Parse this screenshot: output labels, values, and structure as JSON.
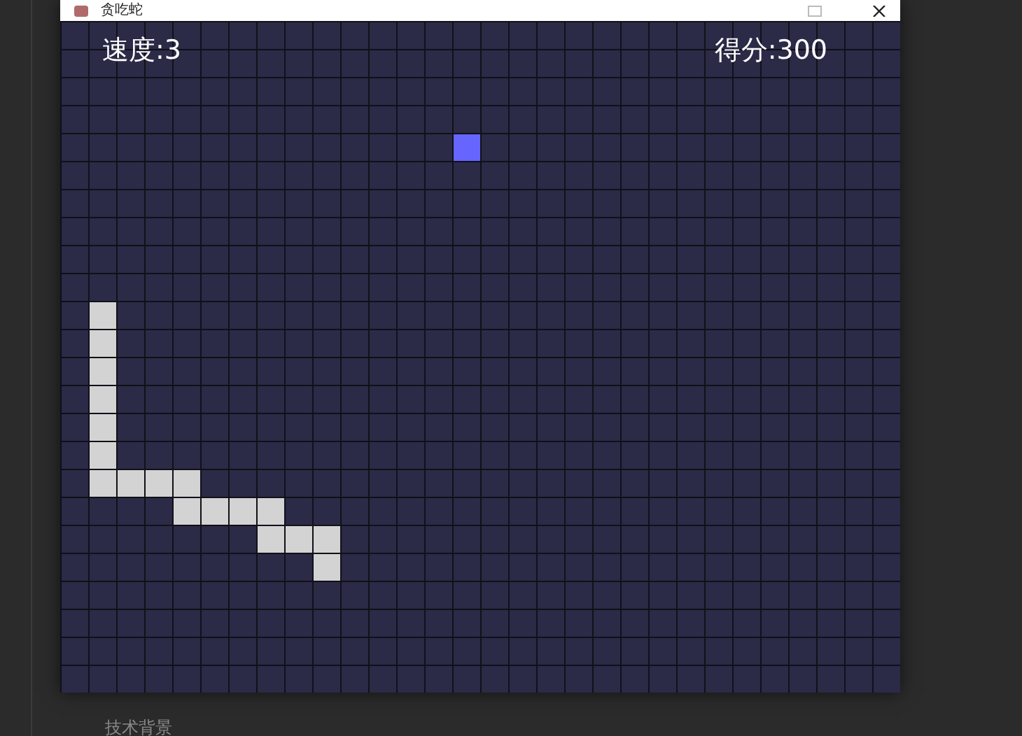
{
  "window": {
    "title": "贪吃蛇"
  },
  "hud": {
    "speed": "速度:3",
    "score": "得分:300"
  },
  "board": {
    "rows": [
      {
        "cells": [
          {
            "kind": "empty"
          },
          {
            "kind": "empty"
          },
          {
            "kind": "empty"
          },
          {
            "kind": "empty"
          },
          {
            "kind": "empty"
          },
          {
            "kind": "empty"
          },
          {
            "kind": "empty"
          },
          {
            "kind": "empty"
          },
          {
            "kind": "empty"
          },
          {
            "kind": "empty"
          },
          {
            "kind": "empty"
          },
          {
            "kind": "empty"
          },
          {
            "kind": "empty"
          },
          {
            "kind": "empty"
          },
          {
            "kind": "empty"
          },
          {
            "kind": "empty"
          },
          {
            "kind": "empty"
          },
          {
            "kind": "empty"
          },
          {
            "kind": "empty"
          },
          {
            "kind": "empty"
          },
          {
            "kind": "empty"
          },
          {
            "kind": "empty"
          },
          {
            "kind": "empty"
          },
          {
            "kind": "empty"
          },
          {
            "kind": "empty"
          },
          {
            "kind": "empty"
          },
          {
            "kind": "empty"
          },
          {
            "kind": "empty"
          },
          {
            "kind": "empty"
          },
          {
            "kind": "empty"
          }
        ]
      },
      {
        "cells": [
          {
            "kind": "empty"
          },
          {
            "kind": "empty"
          },
          {
            "kind": "empty"
          },
          {
            "kind": "empty"
          },
          {
            "kind": "empty"
          },
          {
            "kind": "empty"
          },
          {
            "kind": "empty"
          },
          {
            "kind": "empty"
          },
          {
            "kind": "empty"
          },
          {
            "kind": "empty"
          },
          {
            "kind": "empty"
          },
          {
            "kind": "empty"
          },
          {
            "kind": "empty"
          },
          {
            "kind": "empty"
          },
          {
            "kind": "empty"
          },
          {
            "kind": "empty"
          },
          {
            "kind": "empty"
          },
          {
            "kind": "empty"
          },
          {
            "kind": "empty"
          },
          {
            "kind": "empty"
          },
          {
            "kind": "empty"
          },
          {
            "kind": "empty"
          },
          {
            "kind": "empty"
          },
          {
            "kind": "empty"
          },
          {
            "kind": "empty"
          },
          {
            "kind": "empty"
          },
          {
            "kind": "empty"
          },
          {
            "kind": "empty"
          },
          {
            "kind": "empty"
          },
          {
            "kind": "empty"
          }
        ]
      },
      {
        "cells": [
          {
            "kind": "empty"
          },
          {
            "kind": "empty"
          },
          {
            "kind": "empty"
          },
          {
            "kind": "empty"
          },
          {
            "kind": "empty"
          },
          {
            "kind": "empty"
          },
          {
            "kind": "empty"
          },
          {
            "kind": "empty"
          },
          {
            "kind": "empty"
          },
          {
            "kind": "empty"
          },
          {
            "kind": "empty"
          },
          {
            "kind": "empty"
          },
          {
            "kind": "empty"
          },
          {
            "kind": "empty"
          },
          {
            "kind": "empty"
          },
          {
            "kind": "empty"
          },
          {
            "kind": "empty"
          },
          {
            "kind": "empty"
          },
          {
            "kind": "empty"
          },
          {
            "kind": "empty"
          },
          {
            "kind": "empty"
          },
          {
            "kind": "empty"
          },
          {
            "kind": "empty"
          },
          {
            "kind": "empty"
          },
          {
            "kind": "empty"
          },
          {
            "kind": "empty"
          },
          {
            "kind": "empty"
          },
          {
            "kind": "empty"
          },
          {
            "kind": "empty"
          },
          {
            "kind": "empty"
          }
        ]
      },
      {
        "cells": [
          {
            "kind": "empty"
          },
          {
            "kind": "empty"
          },
          {
            "kind": "empty"
          },
          {
            "kind": "empty"
          },
          {
            "kind": "empty"
          },
          {
            "kind": "empty"
          },
          {
            "kind": "empty"
          },
          {
            "kind": "empty"
          },
          {
            "kind": "empty"
          },
          {
            "kind": "empty"
          },
          {
            "kind": "empty"
          },
          {
            "kind": "empty"
          },
          {
            "kind": "empty"
          },
          {
            "kind": "empty"
          },
          {
            "kind": "empty"
          },
          {
            "kind": "empty"
          },
          {
            "kind": "empty"
          },
          {
            "kind": "empty"
          },
          {
            "kind": "empty"
          },
          {
            "kind": "empty"
          },
          {
            "kind": "empty"
          },
          {
            "kind": "empty"
          },
          {
            "kind": "empty"
          },
          {
            "kind": "empty"
          },
          {
            "kind": "empty"
          },
          {
            "kind": "empty"
          },
          {
            "kind": "empty"
          },
          {
            "kind": "empty"
          },
          {
            "kind": "empty"
          },
          {
            "kind": "empty"
          }
        ]
      },
      {
        "cells": [
          {
            "kind": "empty"
          },
          {
            "kind": "empty"
          },
          {
            "kind": "empty"
          },
          {
            "kind": "empty"
          },
          {
            "kind": "empty"
          },
          {
            "kind": "empty"
          },
          {
            "kind": "empty"
          },
          {
            "kind": "empty"
          },
          {
            "kind": "empty"
          },
          {
            "kind": "empty"
          },
          {
            "kind": "empty"
          },
          {
            "kind": "empty"
          },
          {
            "kind": "empty"
          },
          {
            "kind": "empty"
          },
          {
            "kind": "food"
          },
          {
            "kind": "empty"
          },
          {
            "kind": "empty"
          },
          {
            "kind": "empty"
          },
          {
            "kind": "empty"
          },
          {
            "kind": "empty"
          },
          {
            "kind": "empty"
          },
          {
            "kind": "empty"
          },
          {
            "kind": "empty"
          },
          {
            "kind": "empty"
          },
          {
            "kind": "empty"
          },
          {
            "kind": "empty"
          },
          {
            "kind": "empty"
          },
          {
            "kind": "empty"
          },
          {
            "kind": "empty"
          },
          {
            "kind": "empty"
          }
        ]
      },
      {
        "cells": [
          {
            "kind": "empty"
          },
          {
            "kind": "empty"
          },
          {
            "kind": "empty"
          },
          {
            "kind": "empty"
          },
          {
            "kind": "empty"
          },
          {
            "kind": "empty"
          },
          {
            "kind": "empty"
          },
          {
            "kind": "empty"
          },
          {
            "kind": "empty"
          },
          {
            "kind": "empty"
          },
          {
            "kind": "empty"
          },
          {
            "kind": "empty"
          },
          {
            "kind": "empty"
          },
          {
            "kind": "empty"
          },
          {
            "kind": "empty"
          },
          {
            "kind": "empty"
          },
          {
            "kind": "empty"
          },
          {
            "kind": "empty"
          },
          {
            "kind": "empty"
          },
          {
            "kind": "empty"
          },
          {
            "kind": "empty"
          },
          {
            "kind": "empty"
          },
          {
            "kind": "empty"
          },
          {
            "kind": "empty"
          },
          {
            "kind": "empty"
          },
          {
            "kind": "empty"
          },
          {
            "kind": "empty"
          },
          {
            "kind": "empty"
          },
          {
            "kind": "empty"
          },
          {
            "kind": "empty"
          }
        ]
      },
      {
        "cells": [
          {
            "kind": "empty"
          },
          {
            "kind": "empty"
          },
          {
            "kind": "empty"
          },
          {
            "kind": "empty"
          },
          {
            "kind": "empty"
          },
          {
            "kind": "empty"
          },
          {
            "kind": "empty"
          },
          {
            "kind": "empty"
          },
          {
            "kind": "empty"
          },
          {
            "kind": "empty"
          },
          {
            "kind": "empty"
          },
          {
            "kind": "empty"
          },
          {
            "kind": "empty"
          },
          {
            "kind": "empty"
          },
          {
            "kind": "empty"
          },
          {
            "kind": "empty"
          },
          {
            "kind": "empty"
          },
          {
            "kind": "empty"
          },
          {
            "kind": "empty"
          },
          {
            "kind": "empty"
          },
          {
            "kind": "empty"
          },
          {
            "kind": "empty"
          },
          {
            "kind": "empty"
          },
          {
            "kind": "empty"
          },
          {
            "kind": "empty"
          },
          {
            "kind": "empty"
          },
          {
            "kind": "empty"
          },
          {
            "kind": "empty"
          },
          {
            "kind": "empty"
          },
          {
            "kind": "empty"
          }
        ]
      },
      {
        "cells": [
          {
            "kind": "empty"
          },
          {
            "kind": "empty"
          },
          {
            "kind": "empty"
          },
          {
            "kind": "empty"
          },
          {
            "kind": "empty"
          },
          {
            "kind": "empty"
          },
          {
            "kind": "empty"
          },
          {
            "kind": "empty"
          },
          {
            "kind": "empty"
          },
          {
            "kind": "empty"
          },
          {
            "kind": "empty"
          },
          {
            "kind": "empty"
          },
          {
            "kind": "empty"
          },
          {
            "kind": "empty"
          },
          {
            "kind": "empty"
          },
          {
            "kind": "empty"
          },
          {
            "kind": "empty"
          },
          {
            "kind": "empty"
          },
          {
            "kind": "empty"
          },
          {
            "kind": "empty"
          },
          {
            "kind": "empty"
          },
          {
            "kind": "empty"
          },
          {
            "kind": "empty"
          },
          {
            "kind": "empty"
          },
          {
            "kind": "empty"
          },
          {
            "kind": "empty"
          },
          {
            "kind": "empty"
          },
          {
            "kind": "empty"
          },
          {
            "kind": "empty"
          },
          {
            "kind": "empty"
          }
        ]
      },
      {
        "cells": [
          {
            "kind": "empty"
          },
          {
            "kind": "empty"
          },
          {
            "kind": "empty"
          },
          {
            "kind": "empty"
          },
          {
            "kind": "empty"
          },
          {
            "kind": "empty"
          },
          {
            "kind": "empty"
          },
          {
            "kind": "empty"
          },
          {
            "kind": "empty"
          },
          {
            "kind": "empty"
          },
          {
            "kind": "empty"
          },
          {
            "kind": "empty"
          },
          {
            "kind": "empty"
          },
          {
            "kind": "empty"
          },
          {
            "kind": "empty"
          },
          {
            "kind": "empty"
          },
          {
            "kind": "empty"
          },
          {
            "kind": "empty"
          },
          {
            "kind": "empty"
          },
          {
            "kind": "empty"
          },
          {
            "kind": "empty"
          },
          {
            "kind": "empty"
          },
          {
            "kind": "empty"
          },
          {
            "kind": "empty"
          },
          {
            "kind": "empty"
          },
          {
            "kind": "empty"
          },
          {
            "kind": "empty"
          },
          {
            "kind": "empty"
          },
          {
            "kind": "empty"
          },
          {
            "kind": "empty"
          }
        ]
      },
      {
        "cells": [
          {
            "kind": "empty"
          },
          {
            "kind": "empty"
          },
          {
            "kind": "empty"
          },
          {
            "kind": "empty"
          },
          {
            "kind": "empty"
          },
          {
            "kind": "empty"
          },
          {
            "kind": "empty"
          },
          {
            "kind": "empty"
          },
          {
            "kind": "empty"
          },
          {
            "kind": "empty"
          },
          {
            "kind": "empty"
          },
          {
            "kind": "empty"
          },
          {
            "kind": "empty"
          },
          {
            "kind": "empty"
          },
          {
            "kind": "empty"
          },
          {
            "kind": "empty"
          },
          {
            "kind": "empty"
          },
          {
            "kind": "empty"
          },
          {
            "kind": "empty"
          },
          {
            "kind": "empty"
          },
          {
            "kind": "empty"
          },
          {
            "kind": "empty"
          },
          {
            "kind": "empty"
          },
          {
            "kind": "empty"
          },
          {
            "kind": "empty"
          },
          {
            "kind": "empty"
          },
          {
            "kind": "empty"
          },
          {
            "kind": "empty"
          },
          {
            "kind": "empty"
          },
          {
            "kind": "empty"
          }
        ]
      },
      {
        "cells": [
          {
            "kind": "empty"
          },
          {
            "kind": "snake"
          },
          {
            "kind": "empty"
          },
          {
            "kind": "empty"
          },
          {
            "kind": "empty"
          },
          {
            "kind": "empty"
          },
          {
            "kind": "empty"
          },
          {
            "kind": "empty"
          },
          {
            "kind": "empty"
          },
          {
            "kind": "empty"
          },
          {
            "kind": "empty"
          },
          {
            "kind": "empty"
          },
          {
            "kind": "empty"
          },
          {
            "kind": "empty"
          },
          {
            "kind": "empty"
          },
          {
            "kind": "empty"
          },
          {
            "kind": "empty"
          },
          {
            "kind": "empty"
          },
          {
            "kind": "empty"
          },
          {
            "kind": "empty"
          },
          {
            "kind": "empty"
          },
          {
            "kind": "empty"
          },
          {
            "kind": "empty"
          },
          {
            "kind": "empty"
          },
          {
            "kind": "empty"
          },
          {
            "kind": "empty"
          },
          {
            "kind": "empty"
          },
          {
            "kind": "empty"
          },
          {
            "kind": "empty"
          },
          {
            "kind": "empty"
          }
        ]
      },
      {
        "cells": [
          {
            "kind": "empty"
          },
          {
            "kind": "snake"
          },
          {
            "kind": "empty"
          },
          {
            "kind": "empty"
          },
          {
            "kind": "empty"
          },
          {
            "kind": "empty"
          },
          {
            "kind": "empty"
          },
          {
            "kind": "empty"
          },
          {
            "kind": "empty"
          },
          {
            "kind": "empty"
          },
          {
            "kind": "empty"
          },
          {
            "kind": "empty"
          },
          {
            "kind": "empty"
          },
          {
            "kind": "empty"
          },
          {
            "kind": "empty"
          },
          {
            "kind": "empty"
          },
          {
            "kind": "empty"
          },
          {
            "kind": "empty"
          },
          {
            "kind": "empty"
          },
          {
            "kind": "empty"
          },
          {
            "kind": "empty"
          },
          {
            "kind": "empty"
          },
          {
            "kind": "empty"
          },
          {
            "kind": "empty"
          },
          {
            "kind": "empty"
          },
          {
            "kind": "empty"
          },
          {
            "kind": "empty"
          },
          {
            "kind": "empty"
          },
          {
            "kind": "empty"
          },
          {
            "kind": "empty"
          }
        ]
      },
      {
        "cells": [
          {
            "kind": "empty"
          },
          {
            "kind": "snake"
          },
          {
            "kind": "empty"
          },
          {
            "kind": "empty"
          },
          {
            "kind": "empty"
          },
          {
            "kind": "empty"
          },
          {
            "kind": "empty"
          },
          {
            "kind": "empty"
          },
          {
            "kind": "empty"
          },
          {
            "kind": "empty"
          },
          {
            "kind": "empty"
          },
          {
            "kind": "empty"
          },
          {
            "kind": "empty"
          },
          {
            "kind": "empty"
          },
          {
            "kind": "empty"
          },
          {
            "kind": "empty"
          },
          {
            "kind": "empty"
          },
          {
            "kind": "empty"
          },
          {
            "kind": "empty"
          },
          {
            "kind": "empty"
          },
          {
            "kind": "empty"
          },
          {
            "kind": "empty"
          },
          {
            "kind": "empty"
          },
          {
            "kind": "empty"
          },
          {
            "kind": "empty"
          },
          {
            "kind": "empty"
          },
          {
            "kind": "empty"
          },
          {
            "kind": "empty"
          },
          {
            "kind": "empty"
          },
          {
            "kind": "empty"
          }
        ]
      },
      {
        "cells": [
          {
            "kind": "empty"
          },
          {
            "kind": "snake"
          },
          {
            "kind": "empty"
          },
          {
            "kind": "empty"
          },
          {
            "kind": "empty"
          },
          {
            "kind": "empty"
          },
          {
            "kind": "empty"
          },
          {
            "kind": "empty"
          },
          {
            "kind": "empty"
          },
          {
            "kind": "empty"
          },
          {
            "kind": "empty"
          },
          {
            "kind": "empty"
          },
          {
            "kind": "empty"
          },
          {
            "kind": "empty"
          },
          {
            "kind": "empty"
          },
          {
            "kind": "empty"
          },
          {
            "kind": "empty"
          },
          {
            "kind": "empty"
          },
          {
            "kind": "empty"
          },
          {
            "kind": "empty"
          },
          {
            "kind": "empty"
          },
          {
            "kind": "empty"
          },
          {
            "kind": "empty"
          },
          {
            "kind": "empty"
          },
          {
            "kind": "empty"
          },
          {
            "kind": "empty"
          },
          {
            "kind": "empty"
          },
          {
            "kind": "empty"
          },
          {
            "kind": "empty"
          },
          {
            "kind": "empty"
          }
        ]
      },
      {
        "cells": [
          {
            "kind": "empty"
          },
          {
            "kind": "snake"
          },
          {
            "kind": "empty"
          },
          {
            "kind": "empty"
          },
          {
            "kind": "empty"
          },
          {
            "kind": "empty"
          },
          {
            "kind": "empty"
          },
          {
            "kind": "empty"
          },
          {
            "kind": "empty"
          },
          {
            "kind": "empty"
          },
          {
            "kind": "empty"
          },
          {
            "kind": "empty"
          },
          {
            "kind": "empty"
          },
          {
            "kind": "empty"
          },
          {
            "kind": "empty"
          },
          {
            "kind": "empty"
          },
          {
            "kind": "empty"
          },
          {
            "kind": "empty"
          },
          {
            "kind": "empty"
          },
          {
            "kind": "empty"
          },
          {
            "kind": "empty"
          },
          {
            "kind": "empty"
          },
          {
            "kind": "empty"
          },
          {
            "kind": "empty"
          },
          {
            "kind": "empty"
          },
          {
            "kind": "empty"
          },
          {
            "kind": "empty"
          },
          {
            "kind": "empty"
          },
          {
            "kind": "empty"
          },
          {
            "kind": "empty"
          }
        ]
      },
      {
        "cells": [
          {
            "kind": "empty"
          },
          {
            "kind": "snake"
          },
          {
            "kind": "empty"
          },
          {
            "kind": "empty"
          },
          {
            "kind": "empty"
          },
          {
            "kind": "empty"
          },
          {
            "kind": "empty"
          },
          {
            "kind": "empty"
          },
          {
            "kind": "empty"
          },
          {
            "kind": "empty"
          },
          {
            "kind": "empty"
          },
          {
            "kind": "empty"
          },
          {
            "kind": "empty"
          },
          {
            "kind": "empty"
          },
          {
            "kind": "empty"
          },
          {
            "kind": "empty"
          },
          {
            "kind": "empty"
          },
          {
            "kind": "empty"
          },
          {
            "kind": "empty"
          },
          {
            "kind": "empty"
          },
          {
            "kind": "empty"
          },
          {
            "kind": "empty"
          },
          {
            "kind": "empty"
          },
          {
            "kind": "empty"
          },
          {
            "kind": "empty"
          },
          {
            "kind": "empty"
          },
          {
            "kind": "empty"
          },
          {
            "kind": "empty"
          },
          {
            "kind": "empty"
          },
          {
            "kind": "empty"
          }
        ]
      },
      {
        "cells": [
          {
            "kind": "empty"
          },
          {
            "kind": "snake"
          },
          {
            "kind": "snake"
          },
          {
            "kind": "snake"
          },
          {
            "kind": "snake"
          },
          {
            "kind": "empty"
          },
          {
            "kind": "empty"
          },
          {
            "kind": "empty"
          },
          {
            "kind": "empty"
          },
          {
            "kind": "empty"
          },
          {
            "kind": "empty"
          },
          {
            "kind": "empty"
          },
          {
            "kind": "empty"
          },
          {
            "kind": "empty"
          },
          {
            "kind": "empty"
          },
          {
            "kind": "empty"
          },
          {
            "kind": "empty"
          },
          {
            "kind": "empty"
          },
          {
            "kind": "empty"
          },
          {
            "kind": "empty"
          },
          {
            "kind": "empty"
          },
          {
            "kind": "empty"
          },
          {
            "kind": "empty"
          },
          {
            "kind": "empty"
          },
          {
            "kind": "empty"
          },
          {
            "kind": "empty"
          },
          {
            "kind": "empty"
          },
          {
            "kind": "empty"
          },
          {
            "kind": "empty"
          },
          {
            "kind": "empty"
          }
        ]
      },
      {
        "cells": [
          {
            "kind": "empty"
          },
          {
            "kind": "empty"
          },
          {
            "kind": "empty"
          },
          {
            "kind": "empty"
          },
          {
            "kind": "snake"
          },
          {
            "kind": "snake"
          },
          {
            "kind": "snake"
          },
          {
            "kind": "snake"
          },
          {
            "kind": "empty"
          },
          {
            "kind": "empty"
          },
          {
            "kind": "empty"
          },
          {
            "kind": "empty"
          },
          {
            "kind": "empty"
          },
          {
            "kind": "empty"
          },
          {
            "kind": "empty"
          },
          {
            "kind": "empty"
          },
          {
            "kind": "empty"
          },
          {
            "kind": "empty"
          },
          {
            "kind": "empty"
          },
          {
            "kind": "empty"
          },
          {
            "kind": "empty"
          },
          {
            "kind": "empty"
          },
          {
            "kind": "empty"
          },
          {
            "kind": "empty"
          },
          {
            "kind": "empty"
          },
          {
            "kind": "empty"
          },
          {
            "kind": "empty"
          },
          {
            "kind": "empty"
          },
          {
            "kind": "empty"
          },
          {
            "kind": "empty"
          }
        ]
      },
      {
        "cells": [
          {
            "kind": "empty"
          },
          {
            "kind": "empty"
          },
          {
            "kind": "empty"
          },
          {
            "kind": "empty"
          },
          {
            "kind": "empty"
          },
          {
            "kind": "empty"
          },
          {
            "kind": "empty"
          },
          {
            "kind": "snake"
          },
          {
            "kind": "snake"
          },
          {
            "kind": "snake"
          },
          {
            "kind": "empty"
          },
          {
            "kind": "empty"
          },
          {
            "kind": "empty"
          },
          {
            "kind": "empty"
          },
          {
            "kind": "empty"
          },
          {
            "kind": "empty"
          },
          {
            "kind": "empty"
          },
          {
            "kind": "empty"
          },
          {
            "kind": "empty"
          },
          {
            "kind": "empty"
          },
          {
            "kind": "empty"
          },
          {
            "kind": "empty"
          },
          {
            "kind": "empty"
          },
          {
            "kind": "empty"
          },
          {
            "kind": "empty"
          },
          {
            "kind": "empty"
          },
          {
            "kind": "empty"
          },
          {
            "kind": "empty"
          },
          {
            "kind": "empty"
          },
          {
            "kind": "empty"
          }
        ]
      },
      {
        "cells": [
          {
            "kind": "empty"
          },
          {
            "kind": "empty"
          },
          {
            "kind": "empty"
          },
          {
            "kind": "empty"
          },
          {
            "kind": "empty"
          },
          {
            "kind": "empty"
          },
          {
            "kind": "empty"
          },
          {
            "kind": "empty"
          },
          {
            "kind": "empty"
          },
          {
            "kind": "snake"
          },
          {
            "kind": "empty"
          },
          {
            "kind": "empty"
          },
          {
            "kind": "empty"
          },
          {
            "kind": "empty"
          },
          {
            "kind": "empty"
          },
          {
            "kind": "empty"
          },
          {
            "kind": "empty"
          },
          {
            "kind": "empty"
          },
          {
            "kind": "empty"
          },
          {
            "kind": "empty"
          },
          {
            "kind": "empty"
          },
          {
            "kind": "empty"
          },
          {
            "kind": "empty"
          },
          {
            "kind": "empty"
          },
          {
            "kind": "empty"
          },
          {
            "kind": "empty"
          },
          {
            "kind": "empty"
          },
          {
            "kind": "empty"
          },
          {
            "kind": "empty"
          },
          {
            "kind": "empty"
          }
        ]
      },
      {
        "cells": [
          {
            "kind": "empty"
          },
          {
            "kind": "empty"
          },
          {
            "kind": "empty"
          },
          {
            "kind": "empty"
          },
          {
            "kind": "empty"
          },
          {
            "kind": "empty"
          },
          {
            "kind": "empty"
          },
          {
            "kind": "empty"
          },
          {
            "kind": "empty"
          },
          {
            "kind": "empty"
          },
          {
            "kind": "empty"
          },
          {
            "kind": "empty"
          },
          {
            "kind": "empty"
          },
          {
            "kind": "empty"
          },
          {
            "kind": "empty"
          },
          {
            "kind": "empty"
          },
          {
            "kind": "empty"
          },
          {
            "kind": "empty"
          },
          {
            "kind": "empty"
          },
          {
            "kind": "empty"
          },
          {
            "kind": "empty"
          },
          {
            "kind": "empty"
          },
          {
            "kind": "empty"
          },
          {
            "kind": "empty"
          },
          {
            "kind": "empty"
          },
          {
            "kind": "empty"
          },
          {
            "kind": "empty"
          },
          {
            "kind": "empty"
          },
          {
            "kind": "empty"
          },
          {
            "kind": "empty"
          }
        ]
      },
      {
        "cells": [
          {
            "kind": "empty"
          },
          {
            "kind": "empty"
          },
          {
            "kind": "empty"
          },
          {
            "kind": "empty"
          },
          {
            "kind": "empty"
          },
          {
            "kind": "empty"
          },
          {
            "kind": "empty"
          },
          {
            "kind": "empty"
          },
          {
            "kind": "empty"
          },
          {
            "kind": "empty"
          },
          {
            "kind": "empty"
          },
          {
            "kind": "empty"
          },
          {
            "kind": "empty"
          },
          {
            "kind": "empty"
          },
          {
            "kind": "empty"
          },
          {
            "kind": "empty"
          },
          {
            "kind": "empty"
          },
          {
            "kind": "empty"
          },
          {
            "kind": "empty"
          },
          {
            "kind": "empty"
          },
          {
            "kind": "empty"
          },
          {
            "kind": "empty"
          },
          {
            "kind": "empty"
          },
          {
            "kind": "empty"
          },
          {
            "kind": "empty"
          },
          {
            "kind": "empty"
          },
          {
            "kind": "empty"
          },
          {
            "kind": "empty"
          },
          {
            "kind": "empty"
          },
          {
            "kind": "empty"
          }
        ]
      },
      {
        "cells": [
          {
            "kind": "empty"
          },
          {
            "kind": "empty"
          },
          {
            "kind": "empty"
          },
          {
            "kind": "empty"
          },
          {
            "kind": "empty"
          },
          {
            "kind": "empty"
          },
          {
            "kind": "empty"
          },
          {
            "kind": "empty"
          },
          {
            "kind": "empty"
          },
          {
            "kind": "empty"
          },
          {
            "kind": "empty"
          },
          {
            "kind": "empty"
          },
          {
            "kind": "empty"
          },
          {
            "kind": "empty"
          },
          {
            "kind": "empty"
          },
          {
            "kind": "empty"
          },
          {
            "kind": "empty"
          },
          {
            "kind": "empty"
          },
          {
            "kind": "empty"
          },
          {
            "kind": "empty"
          },
          {
            "kind": "empty"
          },
          {
            "kind": "empty"
          },
          {
            "kind": "empty"
          },
          {
            "kind": "empty"
          },
          {
            "kind": "empty"
          },
          {
            "kind": "empty"
          },
          {
            "kind": "empty"
          },
          {
            "kind": "empty"
          },
          {
            "kind": "empty"
          },
          {
            "kind": "empty"
          }
        ]
      },
      {
        "cells": [
          {
            "kind": "empty"
          },
          {
            "kind": "empty"
          },
          {
            "kind": "empty"
          },
          {
            "kind": "empty"
          },
          {
            "kind": "empty"
          },
          {
            "kind": "empty"
          },
          {
            "kind": "empty"
          },
          {
            "kind": "empty"
          },
          {
            "kind": "empty"
          },
          {
            "kind": "empty"
          },
          {
            "kind": "empty"
          },
          {
            "kind": "empty"
          },
          {
            "kind": "empty"
          },
          {
            "kind": "empty"
          },
          {
            "kind": "empty"
          },
          {
            "kind": "empty"
          },
          {
            "kind": "empty"
          },
          {
            "kind": "empty"
          },
          {
            "kind": "empty"
          },
          {
            "kind": "empty"
          },
          {
            "kind": "empty"
          },
          {
            "kind": "empty"
          },
          {
            "kind": "empty"
          },
          {
            "kind": "empty"
          },
          {
            "kind": "empty"
          },
          {
            "kind": "empty"
          },
          {
            "kind": "empty"
          },
          {
            "kind": "empty"
          },
          {
            "kind": "empty"
          },
          {
            "kind": "empty"
          }
        ]
      }
    ]
  },
  "below_text": "技术背景"
}
